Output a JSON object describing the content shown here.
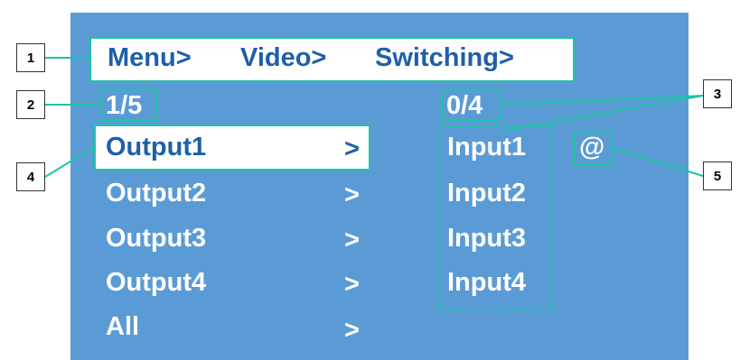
{
  "breadcrumb": [
    "Menu>",
    "Video>",
    "Switching>"
  ],
  "left_page": "1/5",
  "right_page": "0/4",
  "outputs": [
    {
      "label": "Output1",
      "arrow": ">"
    },
    {
      "label": "Output2",
      "arrow": ">"
    },
    {
      "label": "Output3",
      "arrow": ">"
    },
    {
      "label": "Output4",
      "arrow": ">"
    },
    {
      "label": "All",
      "arrow": ">"
    }
  ],
  "inputs": [
    "Input1",
    "Input2",
    "Input3",
    "Input4"
  ],
  "selected_marker": "@",
  "callouts": [
    "1",
    "2",
    "3",
    "4",
    "5"
  ],
  "colors": {
    "screen_bg": "#5b9bd5",
    "highlight_text": "#1f5fa8",
    "annotation": "#1ec4a4"
  }
}
